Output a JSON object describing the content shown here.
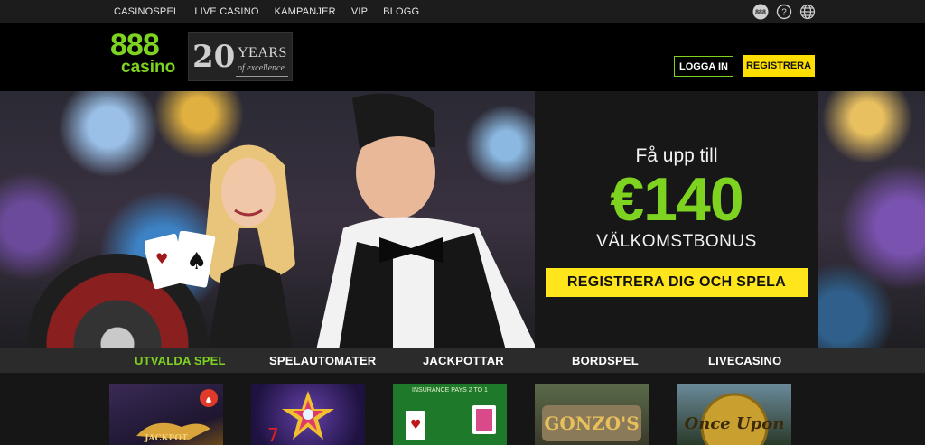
{
  "topnav": {
    "links": [
      "CASINOSPEL",
      "LIVE CASINO",
      "KAMPANJER",
      "VIP",
      "BLOGG"
    ],
    "icons": [
      "888-icon",
      "help-icon",
      "globe-icon"
    ]
  },
  "header": {
    "logo_number": "888",
    "logo_word": "casino",
    "badge_years": "20",
    "badge_word": "YEARS",
    "badge_sub": "of excellence",
    "login_label": "LOGGA IN",
    "register_label": "REGISTRERA"
  },
  "promo": {
    "line1": "Få upp till",
    "amount": "€140",
    "line3": "VÄLKOMSTBONUS",
    "cta": "REGISTRERA DIG OCH SPELA"
  },
  "tabs": [
    "UTVALDA SPEL",
    "SPELAUTOMATER",
    "JACKPOTTAR",
    "BORDSPEL",
    "LIVECASINO"
  ],
  "active_tab": "UTVALDA SPEL",
  "game_tiles": [
    {
      "name": "jackpot-genie",
      "caption": "JACKPOT"
    },
    {
      "name": "starburst",
      "caption": ""
    },
    {
      "name": "blackjack",
      "caption": "INSURANCE PAYS 2 TO 1"
    },
    {
      "name": "gonzos-quest",
      "caption": "GONZO'S"
    },
    {
      "name": "once-upon-a-time",
      "caption": "Once Upon"
    }
  ],
  "colors": {
    "brand_green": "#7ed321",
    "accent_yellow": "#ffdf00",
    "background": "#000000"
  }
}
